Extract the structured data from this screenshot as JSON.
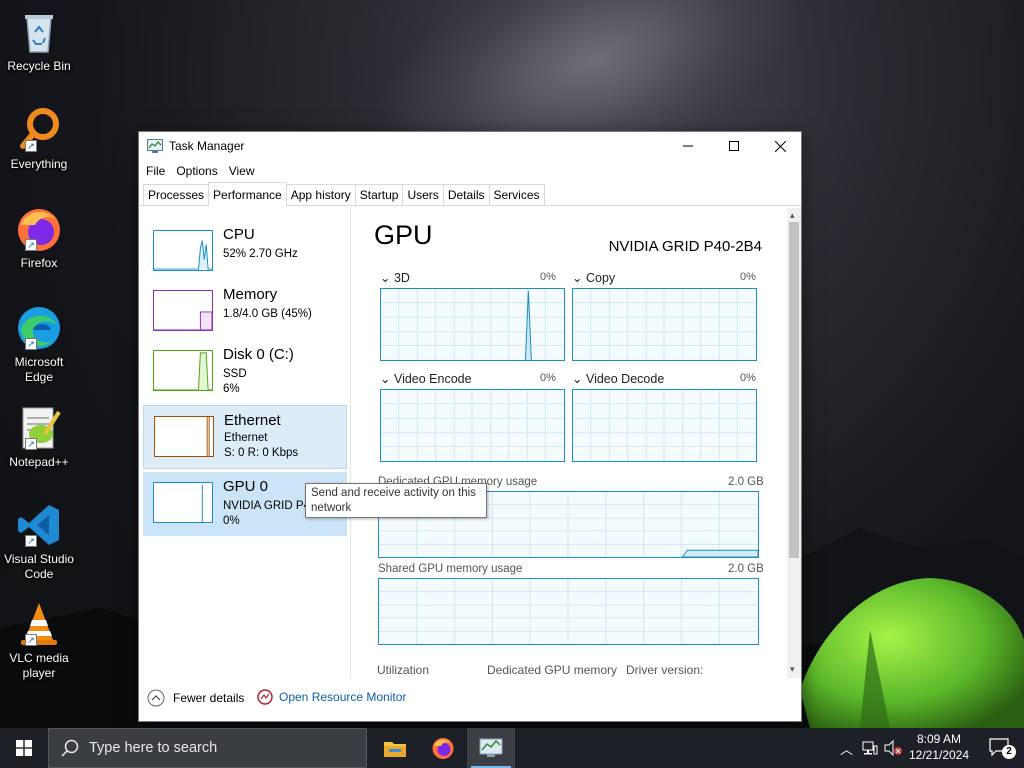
{
  "desktop": {
    "icons": [
      {
        "label": "Recycle Bin",
        "icon": "recycle-bin-icon"
      },
      {
        "label": "Everything",
        "icon": "everything-search-icon"
      },
      {
        "label": "Firefox",
        "icon": "firefox-icon"
      },
      {
        "label": "Microsoft Edge",
        "icon": "edge-icon"
      },
      {
        "label": "Notepad++",
        "icon": "notepadpp-icon"
      },
      {
        "label": "Visual Studio Code",
        "icon": "vscode-icon"
      },
      {
        "label": "VLC media player",
        "icon": "vlc-icon"
      }
    ]
  },
  "window": {
    "title": "Task Manager",
    "menu": [
      "File",
      "Options",
      "View"
    ],
    "tabs": [
      "Processes",
      "Performance",
      "App history",
      "Startup",
      "Users",
      "Details",
      "Services"
    ],
    "active_tab": "Performance"
  },
  "sidebar": {
    "items": [
      {
        "name": "CPU",
        "line1": "52%  2.70 GHz",
        "line2": "",
        "color": "#1a8fc0"
      },
      {
        "name": "Memory",
        "line1": "1.8/4.0 GB (45%)",
        "line2": "",
        "color": "#8b2fb5"
      },
      {
        "name": "Disk 0 (C:)",
        "line1": "SSD",
        "line2": "6%",
        "color": "#4da60c"
      },
      {
        "name": "Ethernet",
        "line1": "Ethernet",
        "line2": "S: 0  R: 0 Kbps",
        "color": "#a74f01"
      },
      {
        "name": "GPU 0",
        "line1": "NVIDIA GRID P4",
        "line2": "0%",
        "color": "#1a8fc0"
      }
    ]
  },
  "gpu": {
    "title": "GPU",
    "model": "NVIDIA GRID P40-2B4",
    "graphs": [
      {
        "label": "3D",
        "pct": "0%"
      },
      {
        "label": "Copy",
        "pct": "0%"
      },
      {
        "label": "Video Encode",
        "pct": "0%"
      },
      {
        "label": "Video Decode",
        "pct": "0%"
      }
    ],
    "dedicated_label": "Dedicated GPU memory usage",
    "dedicated_max": "2.0 GB",
    "shared_label": "Shared GPU memory usage",
    "shared_max": "2.0 GB",
    "stats": [
      "Utilization",
      "Dedicated GPU memory",
      "Driver version:"
    ]
  },
  "tooltip": "Send and receive activity on this network",
  "footer": {
    "fewer_details": "Fewer details",
    "resource_monitor": "Open Resource Monitor"
  },
  "taskbar": {
    "search_placeholder": "Type here to search",
    "time": "8:09 AM",
    "date": "12/21/2024",
    "notifications": "2"
  }
}
